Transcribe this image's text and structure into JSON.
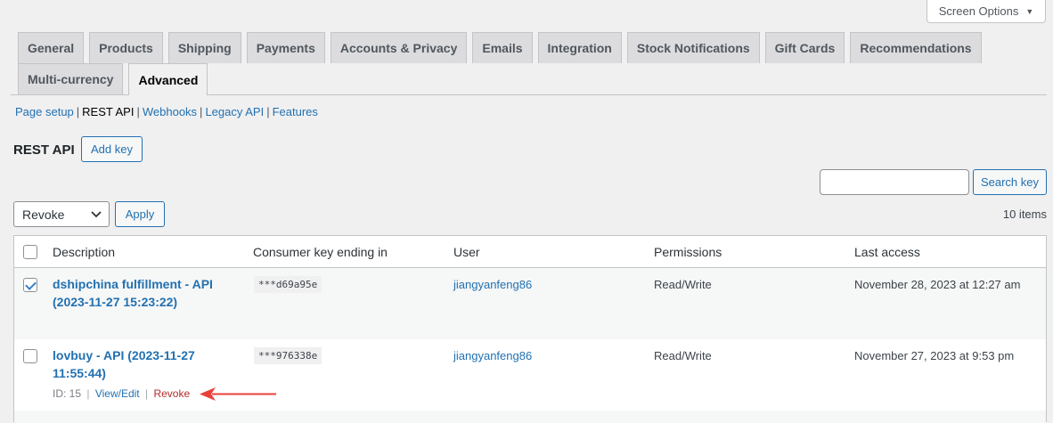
{
  "screen_options": {
    "label": "Screen Options"
  },
  "tabs": [
    {
      "label": "General"
    },
    {
      "label": "Products"
    },
    {
      "label": "Shipping"
    },
    {
      "label": "Payments"
    },
    {
      "label": "Accounts & Privacy"
    },
    {
      "label": "Emails"
    },
    {
      "label": "Integration"
    },
    {
      "label": "Stock Notifications"
    },
    {
      "label": "Gift Cards"
    },
    {
      "label": "Recommendations"
    },
    {
      "label": "Multi-currency"
    },
    {
      "label": "Advanced",
      "active": true
    }
  ],
  "subnav": {
    "page_setup": "Page setup",
    "rest_api": "REST API",
    "webhooks": "Webhooks",
    "legacy_api": "Legacy API",
    "features": "Features",
    "sep": "|"
  },
  "page": {
    "title": "REST API",
    "add_key": "Add key"
  },
  "search": {
    "button": "Search key",
    "value": ""
  },
  "bulk": {
    "selected": "Revoke",
    "apply": "Apply",
    "count": "10 items"
  },
  "table": {
    "columns": {
      "description": "Description",
      "consumer_key": "Consumer key ending in",
      "user": "User",
      "permissions": "Permissions",
      "last_access": "Last access"
    },
    "rows": [
      {
        "checked": true,
        "desc_line1": "dshipchina fulfillment - API",
        "desc_line2": "(2023-11-27 15:23:22)",
        "key": "***d69a95e",
        "user": "jiangyanfeng86",
        "permissions": "Read/Write",
        "last_access": "November 28, 2023 at 12:27 am"
      },
      {
        "checked": false,
        "desc_line1": "lovbuy - API (2023-11-27",
        "desc_line2": "11:55:44)",
        "key": "***976338e",
        "user": "jiangyanfeng86",
        "permissions": "Read/Write",
        "last_access": "November 27, 2023 at 9:53 pm",
        "actions": {
          "id": "ID: 15",
          "edit": "View/Edit",
          "revoke": "Revoke",
          "sep": "|"
        }
      }
    ]
  },
  "colors": {
    "link": "#2271b1",
    "revoke": "#b32d2e",
    "arrow": "#e8413a"
  }
}
